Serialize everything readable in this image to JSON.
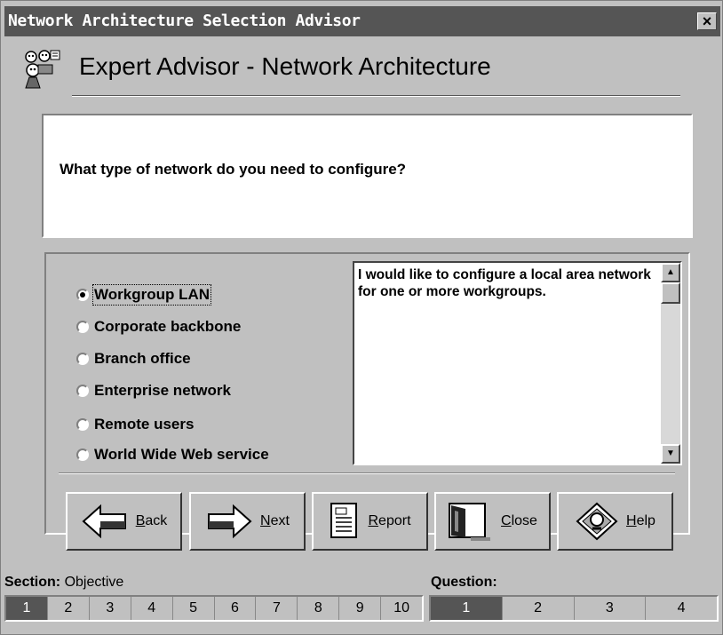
{
  "window": {
    "title": "Network Architecture Selection Advisor",
    "close_label": "×"
  },
  "header": {
    "title": "Expert Advisor - Network Architecture"
  },
  "question": {
    "text": "What type of network do you need to configure?"
  },
  "options": [
    {
      "label": "Workgroup LAN",
      "selected": true
    },
    {
      "label": "Corporate backbone",
      "selected": false
    },
    {
      "label": "Branch office",
      "selected": false
    },
    {
      "label": "Enterprise network",
      "selected": false
    },
    {
      "label": "Remote users",
      "selected": false
    },
    {
      "label": "World Wide Web service",
      "selected": false
    }
  ],
  "description": {
    "text": "I would like to configure a local area network for one or more workgroups."
  },
  "scrollbar": {
    "up_icon": "▲",
    "down_icon": "▼"
  },
  "buttons": {
    "back": {
      "mnemonic": "B",
      "rest": "ack",
      "icon": "arrow-left-icon"
    },
    "next": {
      "mnemonic": "N",
      "rest": "ext",
      "icon": "arrow-right-icon"
    },
    "report": {
      "mnemonic": "R",
      "rest": "eport",
      "icon": "report-icon"
    },
    "close": {
      "mnemonic": "C",
      "rest": "lose",
      "icon": "door-icon"
    },
    "help": {
      "mnemonic": "H",
      "rest": "elp",
      "icon": "help-icon"
    }
  },
  "status": {
    "section_label": "Section:",
    "section_value": "Objective",
    "question_label": "Question:",
    "sections": [
      "1",
      "2",
      "3",
      "4",
      "5",
      "6",
      "7",
      "8",
      "9",
      "10"
    ],
    "active_section": "1",
    "questions": [
      "1",
      "2",
      "3",
      "4"
    ],
    "active_question": "1"
  }
}
